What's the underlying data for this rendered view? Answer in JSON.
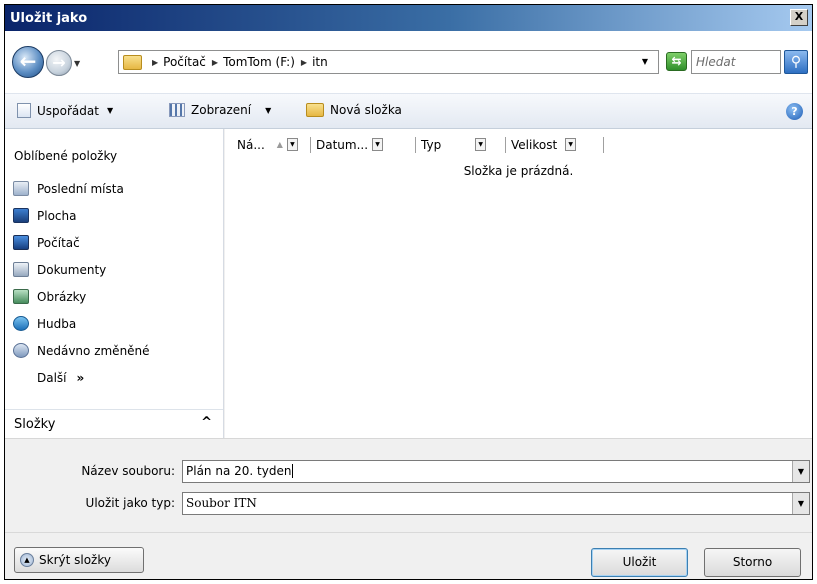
{
  "window": {
    "title": "Uložit jako",
    "close_label": "X"
  },
  "address": {
    "crumbs": [
      "Počítač",
      "TomTom (F:)",
      "itn"
    ],
    "search_placeholder": "Hledat"
  },
  "toolbar": {
    "organize": "Uspořádat",
    "views": "Zobrazení",
    "new_folder": "Nová složka",
    "help": "?"
  },
  "nav": {
    "header": "Oblíbené položky",
    "items": [
      {
        "label": "Poslední místa",
        "icon": "recent-places-icon"
      },
      {
        "label": "Plocha",
        "icon": "desktop-icon"
      },
      {
        "label": "Počítač",
        "icon": "computer-icon"
      },
      {
        "label": "Dokumenty",
        "icon": "documents-icon"
      },
      {
        "label": "Obrázky",
        "icon": "pictures-icon"
      },
      {
        "label": "Hudba",
        "icon": "music-icon"
      },
      {
        "label": "Nedávno změněné",
        "icon": "recently-changed-icon"
      }
    ],
    "more": "Další",
    "more_glyph": "»",
    "folders": "Složky"
  },
  "files": {
    "columns": [
      "Ná...",
      "Datum...",
      "Typ",
      "Velikost"
    ],
    "empty_message": "Složka je prázdná."
  },
  "form": {
    "filename_label": "Název souboru:",
    "filename_value": "Plán na 20. tyden",
    "type_label": "Uložit jako typ:",
    "type_value": "Soubor ITN"
  },
  "buttons": {
    "hide_folders": "Skrýt složky",
    "save": "Uložit",
    "cancel": "Storno"
  }
}
